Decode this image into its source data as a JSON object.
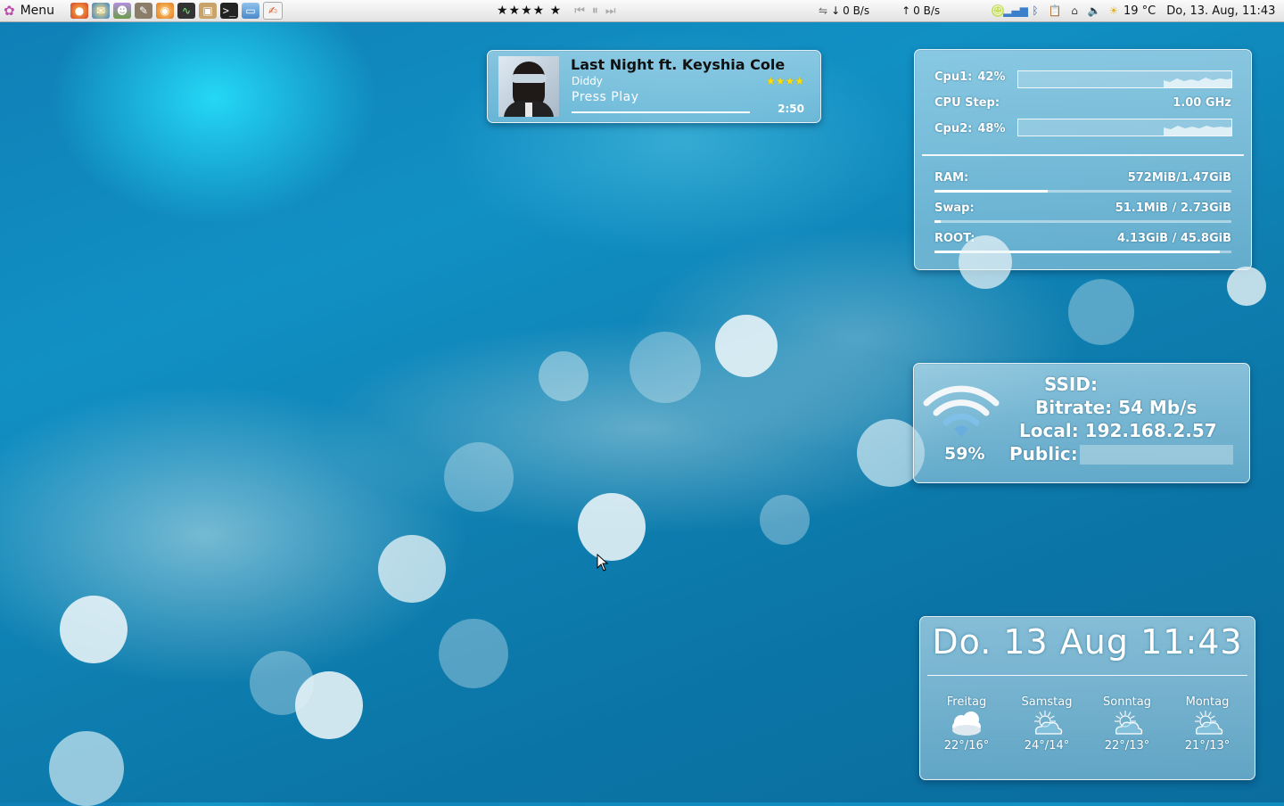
{
  "panel": {
    "menu_label": "Menu",
    "rating": "★★★★ ★",
    "download_rate": "0 B/s",
    "upload_rate": "0 B/s",
    "temperature": "19 °C",
    "datetime": "Do, 13. Aug, 11:43",
    "launchers": [
      "firefox-icon",
      "thunderbird-icon",
      "pidgin-icon",
      "gimp-icon",
      "burner-icon",
      "system-monitor-icon",
      "package-icon",
      "terminal-icon",
      "desktop-icon",
      "text-editor-icon"
    ]
  },
  "player": {
    "title": "Last Night ft. Keyshia Cole",
    "artist": "Diddy",
    "stars": "★★★★",
    "status": "Press Play",
    "time": "2:50",
    "progress": 0
  },
  "system": {
    "cpu1_label": "Cpu1:",
    "cpu1_value": "42%",
    "cpu_step_label": "CPU Step:",
    "cpu_step_value": "1.00 GHz",
    "cpu2_label": "Cpu2:",
    "cpu2_value": "48%",
    "ram_label": "RAM:",
    "ram_value": "572MiB/1.47GiB",
    "ram_fraction": 0.38,
    "swap_label": "Swap:",
    "swap_value": "51.1MiB / 2.73GiB",
    "swap_fraction": 0.02,
    "root_label": "ROOT:",
    "root_value": "4.13GiB / 45.8GiB",
    "root_fraction": 0.96
  },
  "network": {
    "signal": "59%",
    "ssid_label": "SSID:",
    "ssid_value": "",
    "bitrate_label": "Bitrate:",
    "bitrate_value": "54 Mb/s",
    "local_label": "Local:",
    "local_value": "192.168.2.57",
    "public_label": "Public:",
    "public_value": ""
  },
  "clock": {
    "text": "Do. 13 Aug 11:43"
  },
  "weather": [
    {
      "day": "Freitag",
      "temps": "22°/16°",
      "icon": "cloud-icon"
    },
    {
      "day": "Samstag",
      "temps": "24°/14°",
      "icon": "sun-cloud-icon"
    },
    {
      "day": "Sonntag",
      "temps": "22°/13°",
      "icon": "sun-cloud-icon"
    },
    {
      "day": "Montag",
      "temps": "21°/13°",
      "icon": "sun-cloud-icon"
    }
  ]
}
